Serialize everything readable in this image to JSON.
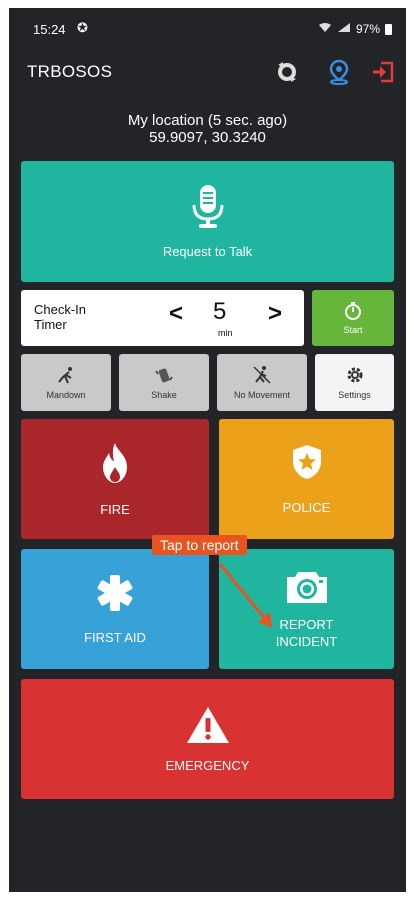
{
  "status_bar": {
    "time": "15:24",
    "right_text": "97%"
  },
  "header": {
    "title": "TRBOSOS"
  },
  "location": {
    "label": "My location (5 sec. ago)",
    "coords": "59.9097, 30.3240"
  },
  "request_to_talk": {
    "label": "Request to Talk"
  },
  "checkin_timer": {
    "label_line1": "Check-In",
    "label_line2": "Timer",
    "value": "5",
    "unit": "min",
    "prev_glyph": "<",
    "next_glyph": ">"
  },
  "start_button": {
    "label": "Start"
  },
  "quick_actions": [
    {
      "label": "Mandown"
    },
    {
      "label": "Shake"
    },
    {
      "label": "No Movement"
    },
    {
      "label": "Settings"
    }
  ],
  "tiles": {
    "fire": "FIRE",
    "police": "POLICE",
    "first_aid": "FIRST AID",
    "report_line1": "REPORT",
    "report_line2": "INCIDENT",
    "emergency": "EMERGENCY"
  },
  "callout": {
    "text": "Tap to report"
  },
  "colors": {
    "background": "#222427",
    "teal": "#1fb59f",
    "green": "#65b63a",
    "fire_red": "#a9272a",
    "police_orange": "#eba11a",
    "first_aid_blue": "#37a2d8",
    "emergency_red": "#d83232",
    "callout_orange": "#e8541f"
  }
}
